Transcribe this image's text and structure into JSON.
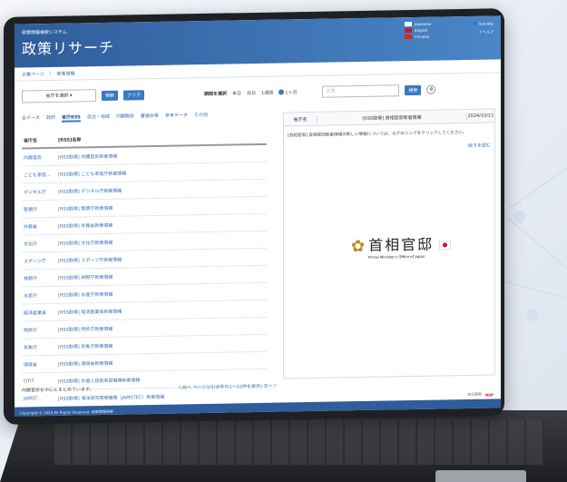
{
  "header": {
    "system_name": "政策情報検索システム",
    "app_title": "政策リサーチ",
    "languages": [
      {
        "label": "Japanese",
        "color": "#ffffff"
      },
      {
        "label": "English",
        "color": "#b22234"
      },
      {
        "label": "Chinese",
        "color": "#de2910"
      }
    ],
    "user_label": "Test Ally",
    "help_label": "ヘルプ",
    "user_icon": "user-icon",
    "help_icon": "help-icon"
  },
  "breadcrumb": {
    "items": [
      "企業ページ",
      "新着情報"
    ]
  },
  "search": {
    "select_label": "省庁を選択",
    "select_icon": "chevron-down-icon",
    "search_button": "検索",
    "clear_button": "クリア",
    "period_label": "期間を選択",
    "period_options": [
      "本日",
      "前日",
      "1週間",
      "1ヶ月"
    ],
    "period_selected": "1ヶ月",
    "keyword_placeholder": "入力",
    "keyword_search_button": "検索",
    "settings_icon": "gear-icon"
  },
  "tabs": [
    "全データ",
    "政府",
    "省庁RSS",
    "自治・地域",
    "内閣関係",
    "審議会等",
    "参考データ",
    "その他"
  ],
  "active_tab": "省庁RSS",
  "list": {
    "headers": [
      "省庁名",
      "[RSS]名称"
    ],
    "rows": [
      {
        "agency": "内閣官房",
        "feed": "[RSS取得] 内閣官房新着情報"
      },
      {
        "agency": "こども家庭...",
        "feed": "[RSS取得] こども家庭庁新着情報"
      },
      {
        "agency": "デジタル庁",
        "feed": "[RSS取得] デジタル庁新着情報"
      },
      {
        "agency": "警察庁",
        "feed": "[RSS取得] 警察庁新着情報"
      },
      {
        "agency": "外務省",
        "feed": "[RSS取得] 外務省新着情報"
      },
      {
        "agency": "文化庁",
        "feed": "[RSS取得] 文化庁新着情報"
      },
      {
        "agency": "スポーツ庁",
        "feed": "[RSS取得] スポーツ庁新着情報"
      },
      {
        "agency": "林野庁",
        "feed": "[RSS取得] 林野庁新着情報"
      },
      {
        "agency": "水産庁",
        "feed": "[RSS取得] 水産庁新着情報"
      },
      {
        "agency": "経済産業省",
        "feed": "[RSS取得] 経済産業省新着情報"
      },
      {
        "agency": "特許庁",
        "feed": "[RSS取得] 特許庁新着情報"
      },
      {
        "agency": "気象庁",
        "feed": "[RSS取得] 気象庁新着情報"
      },
      {
        "agency": "環境省",
        "feed": "[RSS取得] 環境省新着情報"
      },
      {
        "agency": "OTIT",
        "feed": "[RSS取得] 外国人技能実習機構新着情報"
      },
      {
        "agency": "JAMST...",
        "feed": "[RSS取得] 海洋研究開発機構（JAMSTEC）新着情報"
      }
    ],
    "note": "内閣官房を中心とまとめています。",
    "pager": "＜前へ ページ1/5(全件の1～15件を表示) 次へ＞"
  },
  "panel": {
    "headers": [
      "省庁名",
      "[RSS取得] 首相官邸新着情報",
      "2024/10/11"
    ],
    "message": "[首相官邸] 首相官邸新着情報の新しい情報については、以下のリンクをクリックしてください。",
    "read_more": "続きを読む",
    "logo_name": "首相官邸",
    "logo_en": "Prime Minister's Office of Japan",
    "logo_emblem": "paulownia-emblem-icon",
    "flag_icon": "japan-flag-icon"
  },
  "status": {
    "text": "本日更新",
    "logo": "RSP"
  },
  "footer": {
    "copyright": "Copyright © 2024 All Rights Reserved. 政策情報検索"
  },
  "colors": {
    "primary": "#3a78c2",
    "header": "#2f5d9b",
    "accent": "#c8102e"
  }
}
